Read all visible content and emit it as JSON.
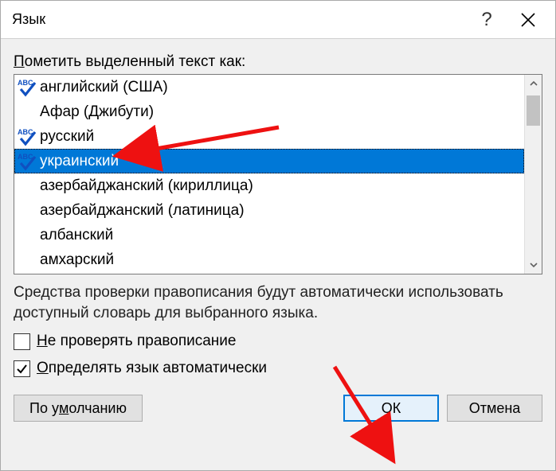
{
  "titlebar": {
    "title": "Язык",
    "help": "?",
    "close": "×"
  },
  "label_prefix": "П",
  "label_rest": "ометить выделенный текст как:",
  "languages": [
    {
      "name": "английский (США)",
      "hasCheck": true,
      "selected": false
    },
    {
      "name": "Афар (Джибути)",
      "hasCheck": false,
      "selected": false
    },
    {
      "name": "русский",
      "hasCheck": true,
      "selected": false
    },
    {
      "name": "украинский",
      "hasCheck": true,
      "selected": true
    },
    {
      "name": "азербайджанский (кириллица)",
      "hasCheck": false,
      "selected": false
    },
    {
      "name": "азербайджанский (латиница)",
      "hasCheck": false,
      "selected": false
    },
    {
      "name": "албанский",
      "hasCheck": false,
      "selected": false
    },
    {
      "name": "амхарский",
      "hasCheck": false,
      "selected": false
    }
  ],
  "info_text": "Средства проверки правописания будут автоматически использовать доступный словарь для выбранного языка.",
  "checkbox1": {
    "prefix": "Н",
    "rest": "е проверять правописание",
    "checked": false
  },
  "checkbox2": {
    "prefix": "О",
    "rest": "пределять язык автоматически",
    "checked": true
  },
  "buttons": {
    "default_prefix": "По у",
    "default_u": "м",
    "default_rest": "олчанию",
    "ok": "ОК",
    "cancel": "Отмена"
  }
}
